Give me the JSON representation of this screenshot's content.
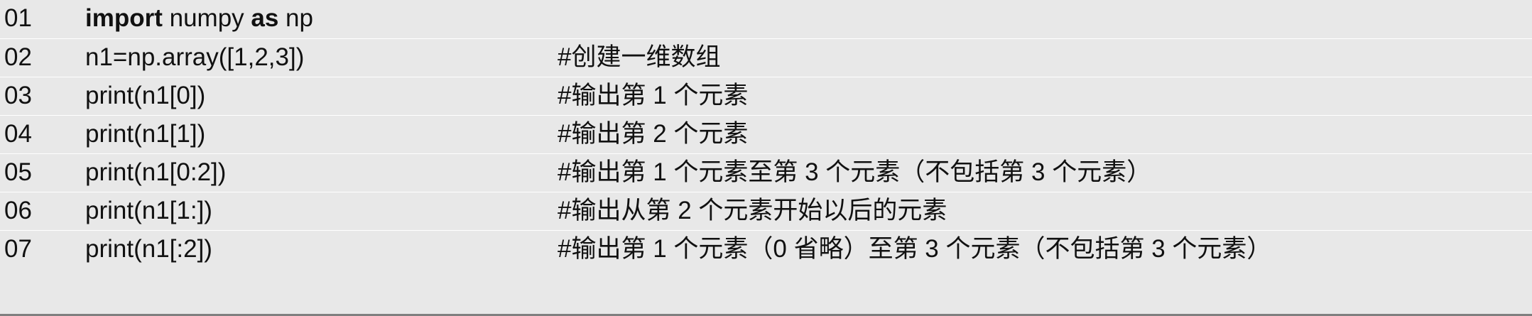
{
  "lines": [
    {
      "num": "01",
      "kw1": "import",
      "mid": " numpy ",
      "kw2": "as",
      "tail": " np",
      "comment": ""
    },
    {
      "num": "02",
      "code": "n1=np.array([1,2,3])",
      "comment": "#创建一维数组"
    },
    {
      "num": "03",
      "code": "print(n1[0])",
      "comment": "#输出第 1 个元素"
    },
    {
      "num": "04",
      "code": "print(n1[1])",
      "comment": "#输出第 2 个元素"
    },
    {
      "num": "05",
      "code": "print(n1[0:2])",
      "comment": "#输出第 1 个元素至第 3 个元素（不包括第 3 个元素）"
    },
    {
      "num": "06",
      "code": "print(n1[1:])",
      "comment": "#输出从第 2 个元素开始以后的元素"
    },
    {
      "num": "07",
      "code": "print(n1[:2])",
      "comment": "#输出第 1 个元素（0 省略）至第 3 个元素（不包括第 3 个元素）"
    }
  ]
}
